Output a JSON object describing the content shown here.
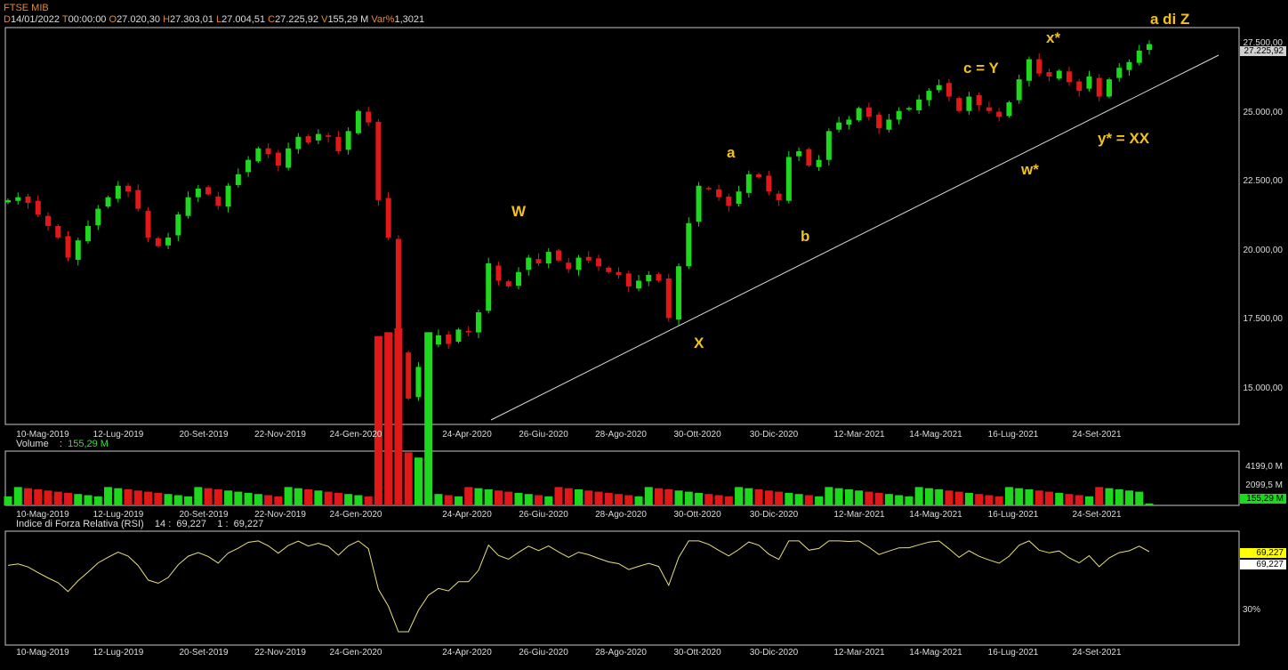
{
  "header": {
    "instrument": "FTSE MIB",
    "d_key": "D",
    "d_val": "14/01/2022",
    "t_key": "T",
    "t_val": "00:00:00",
    "o_key": "O",
    "o_val": "27.020,30",
    "h_key": "H",
    "h_val": "27.303,01",
    "l_key": "L",
    "l_val": "27.004,51",
    "c_key": "C",
    "c_val": "27.225,92",
    "v_key": "V",
    "v_val": "155,29 M",
    "var_key": "Var%",
    "var_val": "1,3021"
  },
  "volume_label": "Volume",
  "volume_value": "155,29 M",
  "rsi_label": "Indice di Forza Relativa (RSI)",
  "rsi_params": "14 :",
  "rsi_value1": "69,227",
  "rsi_param2": "1 :",
  "rsi_value2": "69,227",
  "annotations": [
    {
      "id": "a-di-z",
      "text": "a di Z"
    },
    {
      "id": "x-star",
      "text": "x*"
    },
    {
      "id": "c-y",
      "text": "c = Y"
    },
    {
      "id": "a",
      "text": "a"
    },
    {
      "id": "w",
      "text": "W"
    },
    {
      "id": "b",
      "text": "b"
    },
    {
      "id": "x",
      "text": "X"
    },
    {
      "id": "w-star",
      "text": "w*"
    },
    {
      "id": "y-star-xx",
      "text": "y* = XX"
    }
  ],
  "price_badge": "27.225,92",
  "volume_badge_1": "4199,0 M",
  "volume_badge_2": "2099,5 M",
  "volume_badge_last": "155,29 M",
  "rsi_badge_1": "69,227",
  "rsi_badge_2": "69,227",
  "rsi_level": "30%",
  "colors": {
    "up": "#1ed81e",
    "down": "#e01818",
    "rsi": "#e8e07a",
    "annotation": "#f2c21a",
    "accent": "#e08a3a"
  },
  "chart_data": {
    "type": "candlestick",
    "title": "FTSE MIB",
    "y_ticks": [
      "15.000,00",
      "17.500,00",
      "20.000,00",
      "22.500,00",
      "25.000,00",
      "27.500,00"
    ],
    "y_tick_values": [
      15000,
      17500,
      20000,
      22500,
      25000,
      27500
    ],
    "ylim": [
      14000,
      27800
    ],
    "x_ticks": [
      "10-Mag-2019",
      "12-Lug-2019",
      "20-Set-2019",
      "22-Nov-2019",
      "24-Gen-2020",
      "24-Apr-2020",
      "26-Giu-2020",
      "28-Ago-2020",
      "30-Ott-2020",
      "30-Dic-2020",
      "12-Mar-2021",
      "14-Mag-2021",
      "16-Lug-2021",
      "24-Set-2021"
    ],
    "closes": [
      21800,
      21900,
      21700,
      21300,
      20900,
      20500,
      19800,
      20400,
      20900,
      21500,
      21900,
      22300,
      22100,
      21500,
      20500,
      20200,
      20500,
      21300,
      21900,
      22200,
      22000,
      21600,
      22300,
      22700,
      23200,
      23600,
      23400,
      23000,
      23600,
      24000,
      23800,
      24100,
      24000,
      23500,
      24200,
      24900,
      24500,
      21800,
      20500,
      16500,
      14900,
      16000,
      16800,
      17100,
      16800,
      17300,
      17200,
      17900,
      19600,
      19000,
      18800,
      19300,
      19800,
      19600,
      20000,
      19700,
      19400,
      19800,
      19700,
      19500,
      19300,
      19200,
      18800,
      19000,
      19200,
      19000,
      17700,
      19500,
      21000,
      22300,
      22200,
      21900,
      21600,
      22100,
      22700,
      22600,
      22100,
      21800,
      23300,
      23500,
      23000,
      23200,
      24200,
      24500,
      24600,
      25000,
      24700,
      24300,
      24600,
      24900,
      25000,
      25300,
      25600,
      25800,
      25400,
      24900,
      25400,
      25100,
      24900,
      24700,
      25200,
      26000,
      26700,
      26200,
      26100,
      26300,
      25900,
      25600,
      26100,
      25400,
      26000,
      26400,
      26600,
      27000,
      27226
    ],
    "volume_ylim": [
      0,
      4199
    ],
    "rsi_ylim": [
      20,
      80
    ],
    "rsi_levels": [
      30
    ]
  }
}
